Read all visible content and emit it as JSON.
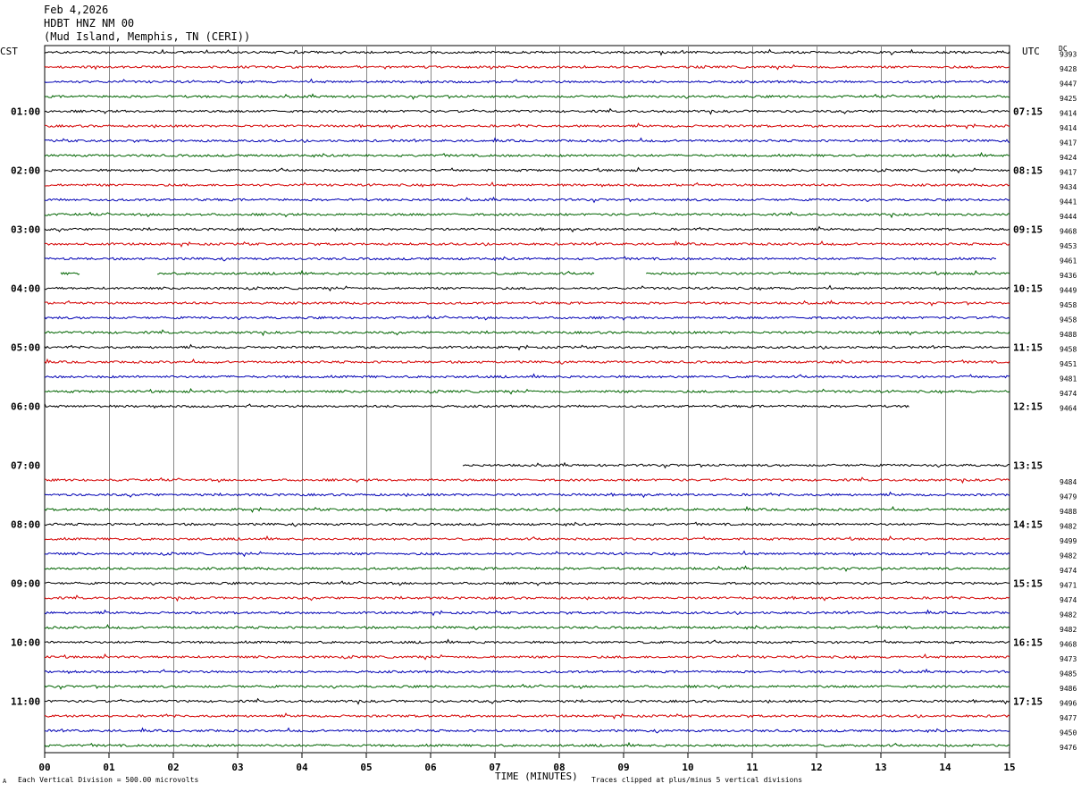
{
  "header": {
    "date": "Feb 4,2026",
    "station": "HDBT HNZ NM 00",
    "location": "(Mud Island, Memphis, TN (CERI))"
  },
  "footer": {
    "left_note": "Each Vertical Division =  500.00 microvolts",
    "right_note": "Traces clipped at plus/minus 5 vertical divisions",
    "mark": "A"
  },
  "chart_data": {
    "type": "line",
    "left_axis_label": "CST",
    "right_axis_label": "UTC",
    "dc_label": "DC",
    "xlabel": "TIME (MINUTES)",
    "x_ticks": [
      "00",
      "01",
      "02",
      "03",
      "04",
      "05",
      "06",
      "07",
      "08",
      "09",
      "10",
      "11",
      "12",
      "13",
      "14",
      "15"
    ],
    "xlim": [
      0,
      15
    ],
    "colors": [
      "#000000",
      "#d40000",
      "#0000b4",
      "#006400"
    ],
    "left_hour_labels": [
      "01:00",
      "02:00",
      "03:00",
      "04:00",
      "05:00",
      "06:00",
      "07:00",
      "08:00",
      "09:00",
      "10:00",
      "11:00"
    ],
    "right_hour_labels": [
      "07:15",
      "08:15",
      "09:15",
      "10:15",
      "11:15",
      "12:15",
      "13:15",
      "14:15",
      "15:15",
      "16:15",
      "17:15"
    ],
    "traces": [
      {
        "row": 0,
        "dc": "9393",
        "segments": [
          [
            0,
            15
          ]
        ]
      },
      {
        "row": 1,
        "dc": "9428",
        "segments": [
          [
            0,
            15
          ]
        ]
      },
      {
        "row": 2,
        "dc": "9447",
        "segments": [
          [
            0,
            15
          ]
        ]
      },
      {
        "row": 3,
        "dc": "9425",
        "segments": [
          [
            0,
            15
          ]
        ]
      },
      {
        "row": 4,
        "dc": "9414",
        "segments": [
          [
            0,
            15
          ]
        ]
      },
      {
        "row": 5,
        "dc": "9414",
        "segments": [
          [
            0,
            15
          ]
        ]
      },
      {
        "row": 6,
        "dc": "9417",
        "segments": [
          [
            0,
            15
          ]
        ]
      },
      {
        "row": 7,
        "dc": "9424",
        "segments": [
          [
            0,
            15
          ]
        ]
      },
      {
        "row": 8,
        "dc": "9417",
        "segments": [
          [
            0,
            15
          ]
        ]
      },
      {
        "row": 9,
        "dc": "9434",
        "segments": [
          [
            0,
            15
          ]
        ]
      },
      {
        "row": 10,
        "dc": "9441",
        "segments": [
          [
            0,
            15
          ]
        ]
      },
      {
        "row": 11,
        "dc": "9444",
        "segments": [
          [
            0,
            15
          ]
        ]
      },
      {
        "row": 12,
        "dc": "9468",
        "segments": [
          [
            0,
            15
          ]
        ]
      },
      {
        "row": 13,
        "dc": "9453",
        "segments": [
          [
            0,
            15
          ]
        ]
      },
      {
        "row": 14,
        "dc": "9461",
        "segments": [
          [
            0,
            14.8
          ]
        ]
      },
      {
        "row": 15,
        "dc": "9436",
        "segments": [
          [
            0.25,
            0.55
          ],
          [
            1.75,
            8.55
          ],
          [
            9.35,
            15
          ]
        ]
      },
      {
        "row": 16,
        "dc": "9449",
        "segments": [
          [
            0,
            15
          ]
        ]
      },
      {
        "row": 17,
        "dc": "9458",
        "segments": [
          [
            0,
            15
          ]
        ]
      },
      {
        "row": 18,
        "dc": "9458",
        "segments": [
          [
            0,
            15
          ]
        ]
      },
      {
        "row": 19,
        "dc": "9488",
        "segments": [
          [
            0,
            15
          ]
        ]
      },
      {
        "row": 20,
        "dc": "9458",
        "segments": [
          [
            0,
            15
          ]
        ]
      },
      {
        "row": 21,
        "dc": "9451",
        "segments": [
          [
            0,
            15
          ]
        ]
      },
      {
        "row": 22,
        "dc": "9481",
        "segments": [
          [
            0,
            15
          ]
        ]
      },
      {
        "row": 23,
        "dc": "9474",
        "segments": [
          [
            0,
            15
          ]
        ]
      },
      {
        "row": 24,
        "dc": "9464",
        "segments": [
          [
            0,
            13.45
          ]
        ]
      },
      {
        "row": 28,
        "dc": "",
        "segments": [
          [
            6.5,
            15
          ]
        ]
      },
      {
        "row": 29,
        "dc": "9484",
        "segments": [
          [
            0,
            15
          ]
        ]
      },
      {
        "row": 30,
        "dc": "9479",
        "segments": [
          [
            0,
            15
          ]
        ]
      },
      {
        "row": 31,
        "dc": "9488",
        "segments": [
          [
            0,
            15
          ]
        ]
      },
      {
        "row": 32,
        "dc": "9482",
        "segments": [
          [
            0,
            15
          ]
        ]
      },
      {
        "row": 33,
        "dc": "9499",
        "segments": [
          [
            0,
            15
          ]
        ]
      },
      {
        "row": 34,
        "dc": "9482",
        "segments": [
          [
            0,
            15
          ]
        ]
      },
      {
        "row": 35,
        "dc": "9474",
        "segments": [
          [
            0,
            15
          ]
        ]
      },
      {
        "row": 36,
        "dc": "9471",
        "segments": [
          [
            0,
            15
          ]
        ]
      },
      {
        "row": 37,
        "dc": "9474",
        "segments": [
          [
            0,
            15
          ]
        ]
      },
      {
        "row": 38,
        "dc": "9482",
        "segments": [
          [
            0,
            15
          ]
        ]
      },
      {
        "row": 39,
        "dc": "9482",
        "segments": [
          [
            0,
            15
          ]
        ]
      },
      {
        "row": 40,
        "dc": "9468",
        "segments": [
          [
            0,
            15
          ]
        ]
      },
      {
        "row": 41,
        "dc": "9473",
        "segments": [
          [
            0,
            15
          ]
        ]
      },
      {
        "row": 42,
        "dc": "9485",
        "segments": [
          [
            0,
            15
          ]
        ]
      },
      {
        "row": 43,
        "dc": "9486",
        "segments": [
          [
            0,
            15
          ]
        ]
      },
      {
        "row": 44,
        "dc": "9496",
        "segments": [
          [
            0,
            15
          ]
        ]
      },
      {
        "row": 45,
        "dc": "9477",
        "segments": [
          [
            0,
            15
          ]
        ]
      },
      {
        "row": 46,
        "dc": "9450",
        "segments": [
          [
            0,
            15
          ]
        ]
      },
      {
        "row": 47,
        "dc": "9476",
        "segments": [
          [
            0,
            15
          ]
        ]
      }
    ]
  }
}
